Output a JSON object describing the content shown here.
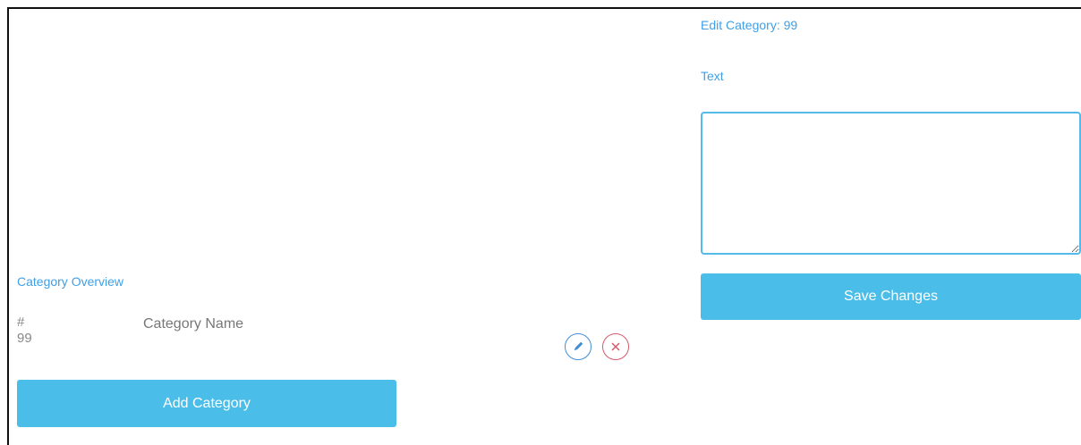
{
  "edit_panel": {
    "title": "Edit Category: 99",
    "text_label": "Text",
    "text_value": "",
    "save_label": "Save Changes"
  },
  "overview": {
    "title": "Category Overview",
    "columns": [
      "#",
      "Category Name"
    ],
    "rows": [
      {
        "id": "99",
        "name": ""
      }
    ],
    "add_label": "Add Category"
  },
  "icons": {
    "edit": "pencil-icon",
    "delete": "close-icon"
  },
  "colors": {
    "accent": "#4bbde9",
    "link_text": "#3f9fe6",
    "edit_icon": "#3f8fd6",
    "delete_icon": "#d65a6a"
  }
}
